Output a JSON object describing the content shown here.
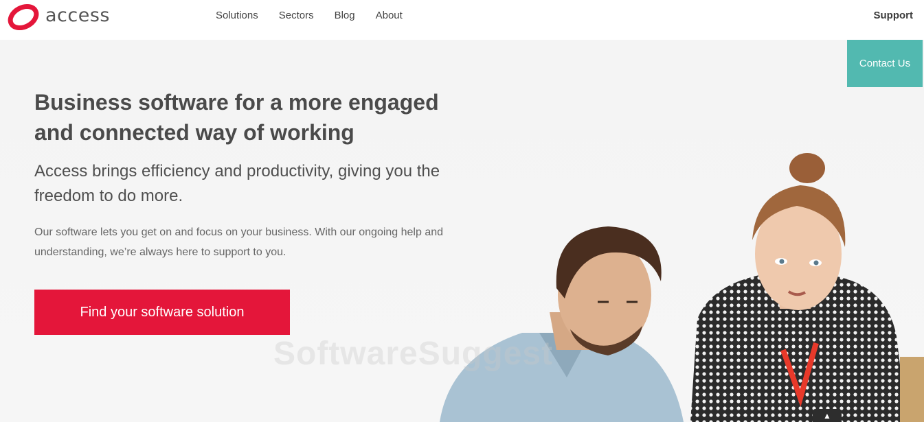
{
  "brand": {
    "name": "access",
    "color": "#e4163a"
  },
  "nav": {
    "items": [
      {
        "label": "Solutions"
      },
      {
        "label": "Sectors"
      },
      {
        "label": "Blog"
      },
      {
        "label": "About"
      }
    ],
    "support_label": "Support",
    "contact_label": "Contact Us"
  },
  "hero": {
    "headline": "Business software for a more engaged and connected way of working",
    "subhead": "Access brings efficiency and productivity, giving you the freedom to do more.",
    "body": "Our software lets you get on and focus on your business. With our ongoing help and understanding, we’re always here to support to you.",
    "cta_label": "Find your software solution"
  },
  "watermark": "SoftwareSuggest",
  "colors": {
    "accent": "#e4163a",
    "contact": "#52b9b0"
  }
}
